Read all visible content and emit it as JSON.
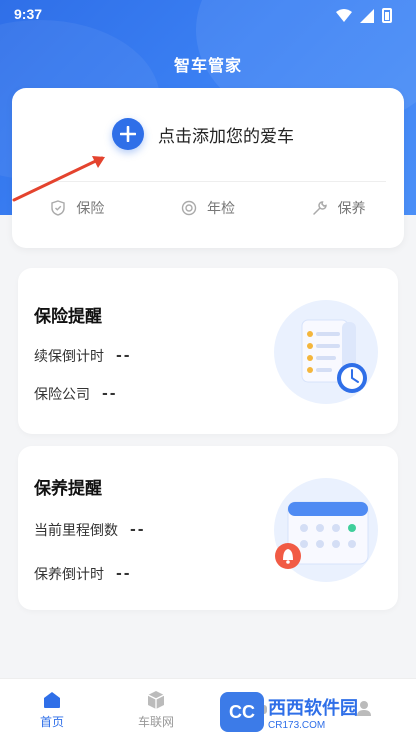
{
  "status_bar": {
    "time": "9:37"
  },
  "app": {
    "title": "智车管家"
  },
  "add_car": {
    "label": "点击添加您的爱车"
  },
  "quick_actions": [
    {
      "label": "保险",
      "icon": "shield-icon"
    },
    {
      "label": "年检",
      "icon": "target-icon"
    },
    {
      "label": "保养",
      "icon": "wrench-icon"
    }
  ],
  "insurance_card": {
    "title": "保险提醒",
    "renew_label": "续保倒计时",
    "renew_value": "--",
    "company_label": "保险公司",
    "company_value": "--"
  },
  "maintenance_card": {
    "title": "保养提醒",
    "mileage_label": "当前里程倒数",
    "mileage_value": "--",
    "countdown_label": "保养倒计时",
    "countdown_value": "--"
  },
  "bottom_nav": [
    {
      "label": "首页",
      "icon": "home-icon",
      "active": true
    },
    {
      "label": "车联网",
      "icon": "cube-icon",
      "active": false
    },
    {
      "label": "",
      "icon": "car-icon",
      "active": false
    },
    {
      "label": "",
      "icon": "user-icon",
      "active": false
    }
  ],
  "watermark": {
    "badge": "CC",
    "main": "西西软件园",
    "site": "CR173.COM"
  },
  "colors": {
    "accent": "#2f6fe8",
    "background": "#f4f5f7"
  }
}
